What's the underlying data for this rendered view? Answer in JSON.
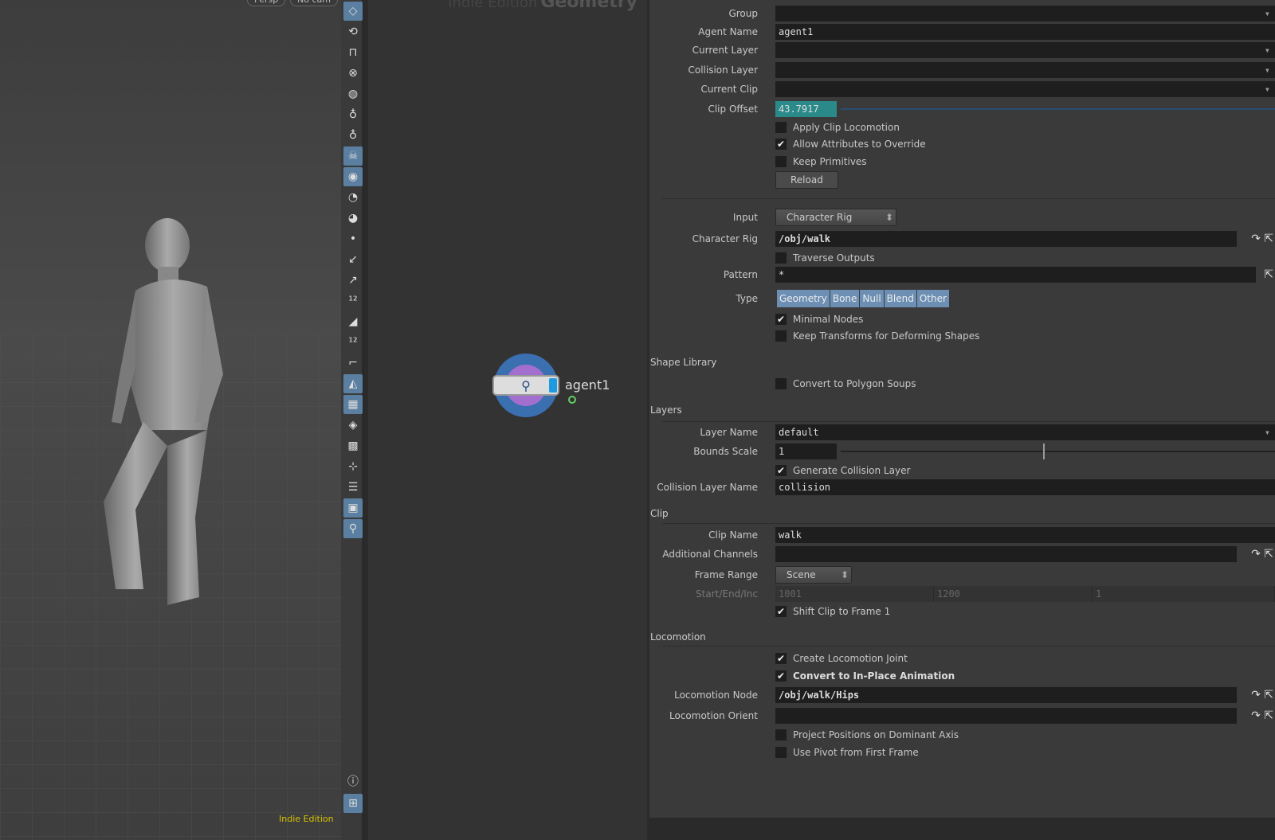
{
  "viewport": {
    "persp_label": "Persp",
    "cam_label": "No cam",
    "edition_label": "Indie Edition"
  },
  "network": {
    "watermark_edition": "Indie Edition",
    "watermark_context": "Geometry",
    "node_name": "agent1"
  },
  "params": {
    "group": {
      "label": "Group",
      "value": ""
    },
    "agent_name": {
      "label": "Agent Name",
      "value": "agent1"
    },
    "current_layer": {
      "label": "Current Layer",
      "value": ""
    },
    "collision_layer": {
      "label": "Collision Layer",
      "value": ""
    },
    "current_clip": {
      "label": "Current Clip",
      "value": ""
    },
    "clip_offset": {
      "label": "Clip Offset",
      "value": "43.7917"
    },
    "apply_clip_locomotion": {
      "label": "Apply Clip Locomotion",
      "checked": false
    },
    "allow_attributes": {
      "label": "Allow Attributes to Override",
      "checked": true
    },
    "keep_primitives": {
      "label": "Keep Primitives",
      "checked": false
    },
    "reload": "Reload",
    "input": {
      "label": "Input",
      "value": "Character Rig"
    },
    "character_rig": {
      "label": "Character Rig",
      "value": "/obj/walk"
    },
    "traverse_outputs": {
      "label": "Traverse Outputs",
      "checked": false
    },
    "pattern": {
      "label": "Pattern",
      "value": "*"
    },
    "type": {
      "label": "Type",
      "options": [
        "Geometry",
        "Bone",
        "Null",
        "Blend",
        "Other"
      ]
    },
    "minimal_nodes": {
      "label": "Minimal Nodes",
      "checked": true
    },
    "keep_transforms": {
      "label": "Keep Transforms for Deforming Shapes",
      "checked": false
    },
    "shape_library": "Shape Library",
    "convert_polysoups": {
      "label": "Convert to Polygon Soups",
      "checked": false
    },
    "layers": "Layers",
    "layer_name": {
      "label": "Layer Name",
      "value": "default"
    },
    "bounds_scale": {
      "label": "Bounds Scale",
      "value": "1"
    },
    "gen_collision": {
      "label": "Generate Collision Layer",
      "checked": true
    },
    "collision_layer_name": {
      "label": "Collision Layer Name",
      "value": "collision"
    },
    "clip": "Clip",
    "clip_name": {
      "label": "Clip Name",
      "value": "walk"
    },
    "additional_channels": {
      "label": "Additional Channels",
      "value": ""
    },
    "frame_range": {
      "label": "Frame Range",
      "value": "Scene"
    },
    "start_end_inc": {
      "label": "Start/End/Inc",
      "start": "1001",
      "end": "1200",
      "inc": "1"
    },
    "shift_clip": {
      "label": "Shift Clip to Frame 1",
      "checked": true
    },
    "locomotion": "Locomotion",
    "create_loco_joint": {
      "label": "Create Locomotion Joint",
      "checked": true
    },
    "convert_inplace": {
      "label": "Convert to In-Place Animation",
      "checked": true
    },
    "loco_node": {
      "label": "Locomotion Node",
      "value": "/obj/walk/Hips"
    },
    "loco_orient": {
      "label": "Locomotion Orient",
      "value": ""
    },
    "project_positions": {
      "label": "Project Positions on Dominant Axis",
      "checked": false
    },
    "use_pivot": {
      "label": "Use Pivot from First Frame",
      "checked": false
    }
  }
}
